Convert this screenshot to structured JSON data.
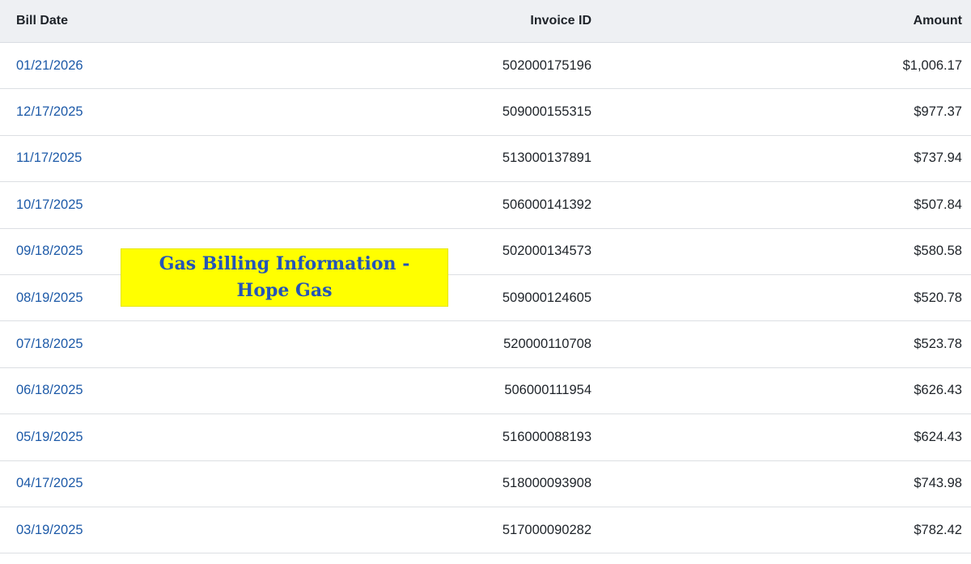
{
  "table": {
    "headers": {
      "bill_date": "Bill Date",
      "invoice_id": "Invoice ID",
      "amount": "Amount"
    },
    "rows": [
      {
        "bill_date": "01/21/2026",
        "invoice_id": "502000175196",
        "amount": "$1,006.17"
      },
      {
        "bill_date": "12/17/2025",
        "invoice_id": "509000155315",
        "amount": "$977.37"
      },
      {
        "bill_date": "11/17/2025",
        "invoice_id": "513000137891",
        "amount": "$737.94"
      },
      {
        "bill_date": "10/17/2025",
        "invoice_id": "506000141392",
        "amount": "$507.84"
      },
      {
        "bill_date": "09/18/2025",
        "invoice_id": "502000134573",
        "amount": "$580.58"
      },
      {
        "bill_date": "08/19/2025",
        "invoice_id": "509000124605",
        "amount": "$520.78"
      },
      {
        "bill_date": "07/18/2025",
        "invoice_id": "520000110708",
        "amount": "$523.78"
      },
      {
        "bill_date": "06/18/2025",
        "invoice_id": "506000111954",
        "amount": "$626.43"
      },
      {
        "bill_date": "05/19/2025",
        "invoice_id": "516000088193",
        "amount": "$624.43"
      },
      {
        "bill_date": "04/17/2025",
        "invoice_id": "518000093908",
        "amount": "$743.98"
      },
      {
        "bill_date": "03/19/2025",
        "invoice_id": "517000090282",
        "amount": "$782.42"
      }
    ]
  },
  "overlay": {
    "line1": "Gas Billing Information -",
    "line2": "Hope Gas"
  },
  "colors": {
    "link": "#1d5aa8",
    "header_bg": "#eef0f3",
    "overlay_bg": "#ffff00",
    "overlay_text": "#2454b8"
  }
}
